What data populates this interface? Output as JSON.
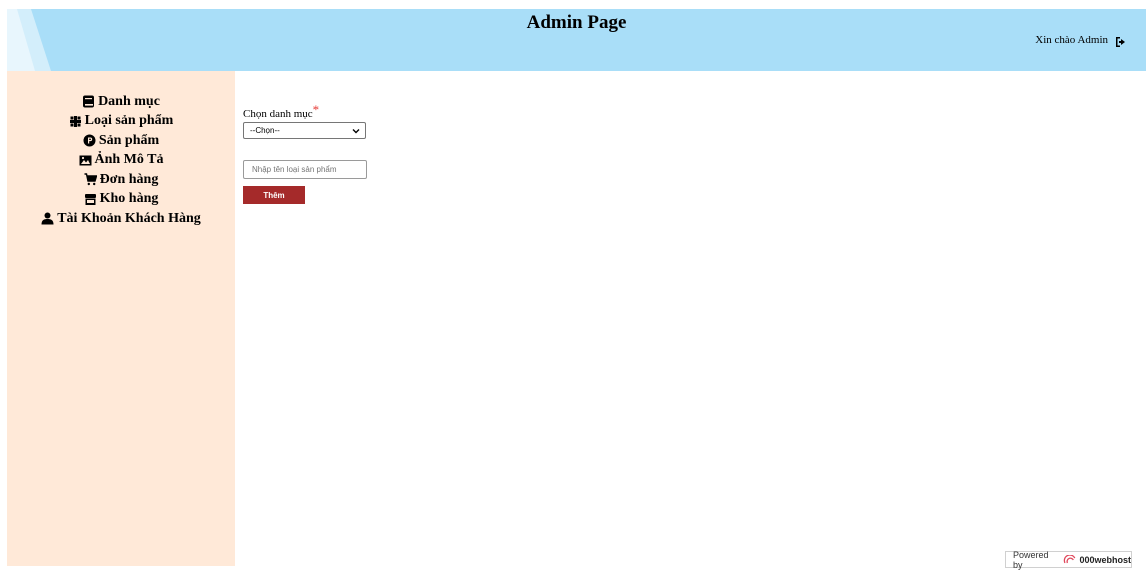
{
  "header": {
    "title": "Admin Page",
    "greeting": "Xin chào Admin",
    "logout_icon": "sign-out-icon",
    "background_color": "#a9def8"
  },
  "sidebar": {
    "background_color": "#ffe9d8",
    "items": [
      {
        "label": "Danh mục",
        "icon": "book-icon"
      },
      {
        "label": "Loại sản phẩm",
        "icon": "grid-icon"
      },
      {
        "label": "Sản phẩm",
        "icon": "product-icon"
      },
      {
        "label": "Ảnh Mô Tả",
        "icon": "image-icon"
      },
      {
        "label": "Đơn hàng",
        "icon": "cart-icon"
      },
      {
        "label": "Kho hàng",
        "icon": "store-icon"
      },
      {
        "label": "Tài Khoản Khách Hàng",
        "icon": "user-icon"
      }
    ]
  },
  "form": {
    "category_label": "Chọn danh mục",
    "required_mark": "*",
    "category_select_value": "--Chọn--",
    "product_type_placeholder": "Nhập tên loại sản phẩm",
    "submit_label": "Thêm",
    "submit_color": "#a52a2a"
  },
  "footer": {
    "powered_by": "Powered by",
    "brand": "000webhost"
  }
}
